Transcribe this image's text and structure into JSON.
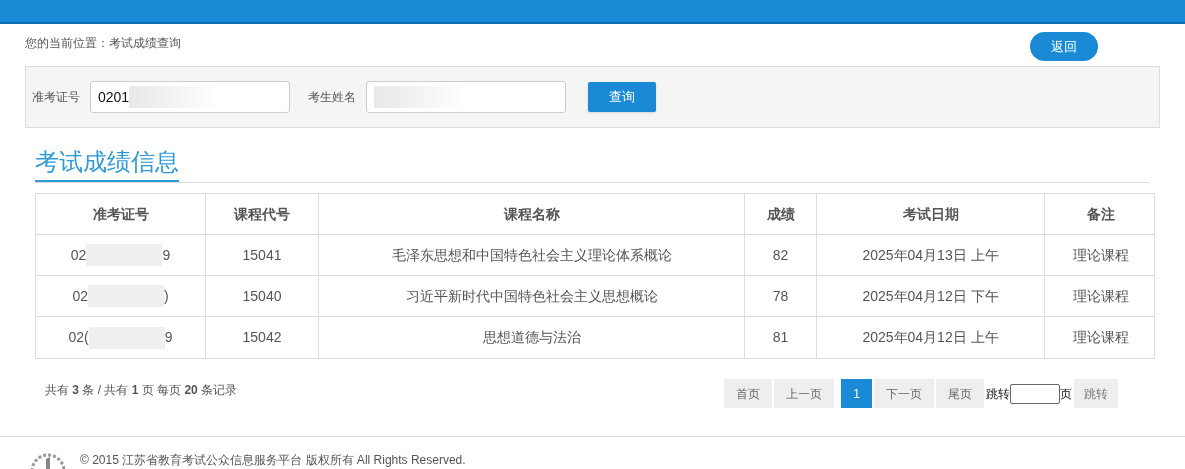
{
  "breadcrumb": "您的当前位置：考试成绩查询",
  "back_button": "返回",
  "search": {
    "fields": [
      {
        "label": "准考证号",
        "value": "0201"
      },
      {
        "label": "考生姓名"
      }
    ],
    "button": "查询"
  },
  "section_title": "考试成绩信息",
  "table": {
    "columns": [
      "准考证号",
      "课程代号",
      "课程名称",
      "成绩",
      "考试日期",
      "备注"
    ],
    "rows": [
      {
        "id_tail": "9",
        "cells": [
          "02",
          "15041",
          "毛泽东思想和中国特色社会主义理论体系概论",
          "82",
          "2025年04月13日 上午",
          "理论课程"
        ]
      },
      {
        "id_tail": ")",
        "cells": [
          "02",
          "15040",
          "习近平新时代中国特色社会主义思想概论",
          "78",
          "2025年04月12日 下午",
          "理论课程"
        ]
      },
      {
        "id_tail": "9",
        "cells": [
          "02(",
          "15042",
          "思想道德与法治",
          "81",
          "2025年04月12日 上午",
          "理论课程"
        ]
      }
    ]
  },
  "summary": "共有 **3** 条 / 共有 **1** 页 每页 **20** 条记录",
  "pagination": {
    "buttons": [
      {
        "label": "首页",
        "selected": false
      },
      {
        "label": "上一页",
        "selected": false
      },
      {
        "label": "1",
        "selected": true
      },
      {
        "label": "下一页",
        "selected": false
      },
      {
        "label": "尾页",
        "selected": false
      }
    ],
    "jump_label": "跳转",
    "page_unit": "页",
    "jump_button": "跳转"
  },
  "footer": "© 2015 江苏省教育考试公众信息服务平台 版权所有 All Rights Reserved."
}
